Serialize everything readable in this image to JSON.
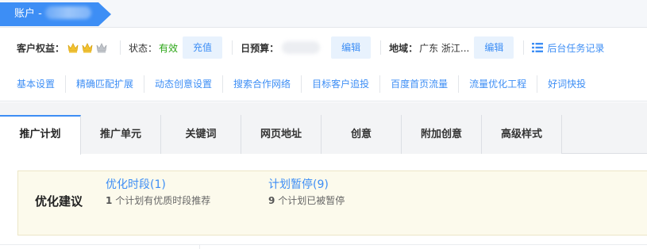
{
  "breadcrumb": {
    "label": "账户 -"
  },
  "info": {
    "rights_label": "客户权益：",
    "status_label": "状态：",
    "status_value": "有效",
    "recharge_button": "充值",
    "budget_label": "日预算：",
    "budget_edit": "编辑",
    "region_label": "地域：",
    "region_value": "广东 浙江...",
    "region_edit": "编辑",
    "task_link": "后台任务记录"
  },
  "tools": [
    "基本设置",
    "精确匹配扩展",
    "动态创意设置",
    "搜索合作网络",
    "目标客户追投",
    "百度首页流量",
    "流量优化工程",
    "好词快投"
  ],
  "tabs": [
    "推广计划",
    "推广单元",
    "关键词",
    "网页地址",
    "创意",
    "附加创意",
    "高级样式"
  ],
  "suggest": {
    "title": "优化建议",
    "items": [
      {
        "link": "优化时段(1)",
        "count": "1",
        "desc": "个计划有优质时段推荐"
      },
      {
        "link": "计划暂停(9)",
        "count": "9",
        "desc": "个计划已被暂停"
      }
    ]
  },
  "colors": {
    "accent": "#3d8ef5",
    "status_ok": "#2aa515",
    "crown_gold": "#f2c230",
    "crown_gray": "#bfc3c9"
  }
}
